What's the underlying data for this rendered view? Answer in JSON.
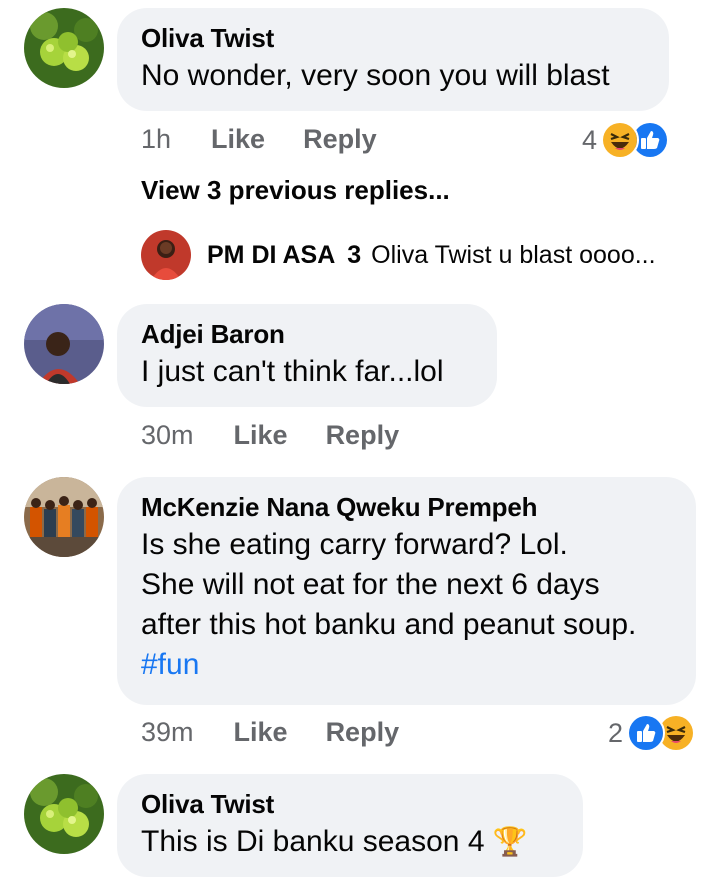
{
  "comments": [
    {
      "author": "Oliva Twist",
      "text": "No wonder, very soon you will blast",
      "time": "1h",
      "like": "Like",
      "reply": "Reply",
      "reaction_count": "4",
      "reactions": [
        "haha-icon",
        "like-icon"
      ]
    },
    {
      "author": "Adjei Baron",
      "text": "I just can't think far...lol",
      "time": "30m",
      "like": "Like",
      "reply": "Reply"
    },
    {
      "author": "McKenzie Nana Qweku Prempeh",
      "lines": [
        "Is she eating carry forward? Lol.",
        "She will not eat for the next 6 days",
        "after this hot banku and peanut soup."
      ],
      "hashtag": "#fun",
      "time": "39m",
      "like": "Like",
      "reply": "Reply",
      "reaction_count": "2",
      "reactions": [
        "like-icon",
        "haha-icon"
      ]
    },
    {
      "author": "Oliva Twist",
      "text": "This is Di banku season 4",
      "emoji": "🏆"
    }
  ],
  "view_previous": "View 3 previous replies...",
  "reply_preview": {
    "author": "PM DI ASA",
    "count": "3",
    "snippet": "Oliva Twist u blast oooo..."
  },
  "colors": {
    "bubble": "#f0f2f5",
    "meta": "#65676b",
    "like_blue": "#1877f2",
    "haha_yellow": "#f7b125"
  }
}
